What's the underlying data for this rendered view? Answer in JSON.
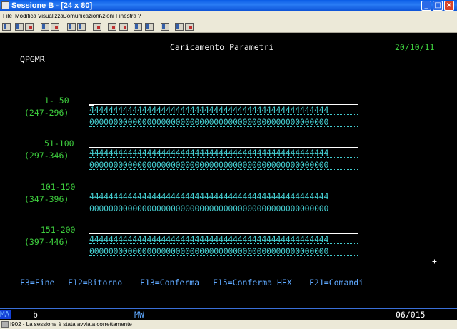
{
  "window": {
    "title": "Sessione B - [24 x 80]"
  },
  "menu": [
    "File",
    "Modifica",
    "Visualizza",
    "Comunicazioni",
    "Azioni",
    "Finestra",
    "?"
  ],
  "screen": {
    "header_title": "Caricamento Parametri",
    "date": "20/10/11",
    "program": "QPGMR",
    "groups": [
      {
        "range": "1- 50",
        "offset": "(247-296)",
        "row1": "44444444444444444444444444444444444444444444444444",
        "row2": "00000000000000000000000000000000000000000000000000"
      },
      {
        "range": "51-100",
        "offset": "(297-346)",
        "row1": "44444444444444444444444444444444444444444444444444",
        "row2": "00000000000000000000000000000000000000000000000000"
      },
      {
        "range": "101-150",
        "offset": "(347-396)",
        "row1": "44444444444444444444444444444444444444444444444444",
        "row2": "00000000000000000000000000000000000000000000000000"
      },
      {
        "range": "151-200",
        "offset": "(397-446)",
        "row1": "44444444444444444444444444444444444444444444444444",
        "row2": "00000000000000000000000000000000000000000000000000"
      }
    ],
    "plus_marker": "+",
    "fkeys": [
      "F3=Fine",
      "F12=Ritorno",
      "F13=Conferma",
      "F15=Conferma HEX",
      "F21=Comandi"
    ]
  },
  "oia": {
    "mode": "MA",
    "indicator": "b",
    "mw": "MW",
    "cursor_pos": "06/015"
  },
  "status_bar": {
    "message": "I902 - La sessione è stata avviata correttamente"
  },
  "colors": {
    "green": "#3ecf3e",
    "blue": "#5fa9ff",
    "turquoise": "#44cdd0",
    "white": "#ffffff",
    "background": "#000000"
  }
}
